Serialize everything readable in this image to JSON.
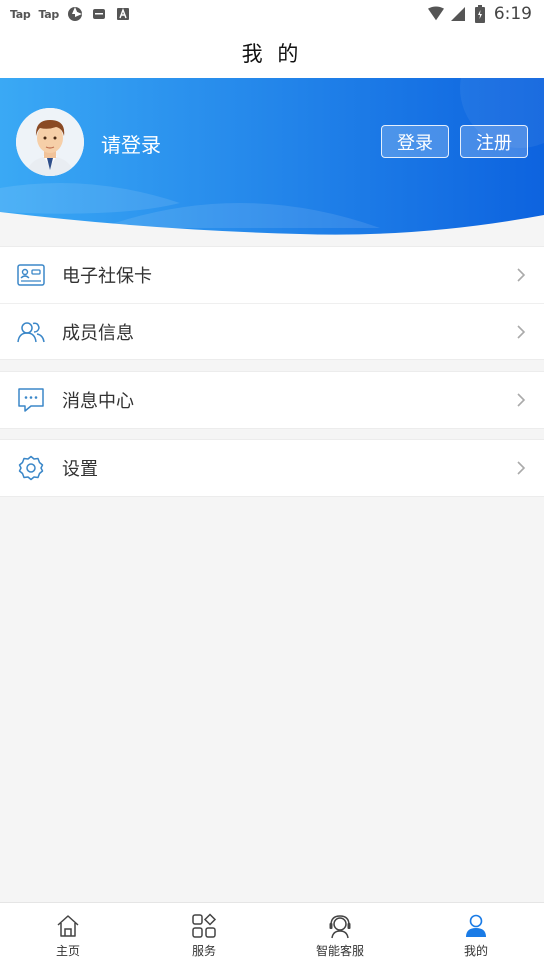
{
  "status_bar": {
    "app_label_1": "Tap",
    "app_label_2": "Tap",
    "time": "6:19"
  },
  "title": "我 的",
  "header": {
    "login_prompt": "请登录",
    "login_button": "登录",
    "register_button": "注册"
  },
  "menu": {
    "group1": [
      {
        "label": "电子社保卡",
        "icon": "social-security-card-icon"
      },
      {
        "label": "成员信息",
        "icon": "members-icon"
      }
    ],
    "group2": [
      {
        "label": "消息中心",
        "icon": "message-icon"
      }
    ],
    "group3": [
      {
        "label": "设置",
        "icon": "gear-icon"
      }
    ]
  },
  "bottom_nav": {
    "items": [
      {
        "label": "主页",
        "icon": "home-icon"
      },
      {
        "label": "服务",
        "icon": "grid-icon"
      },
      {
        "label": "智能客服",
        "icon": "headset-icon"
      },
      {
        "label": "我的",
        "icon": "user-icon",
        "active": true
      }
    ]
  },
  "colors": {
    "accent": "#1a7be6",
    "banner_start": "#3aa9f5",
    "banner_end": "#0d63df",
    "icon_blue": "#3b87c8"
  }
}
